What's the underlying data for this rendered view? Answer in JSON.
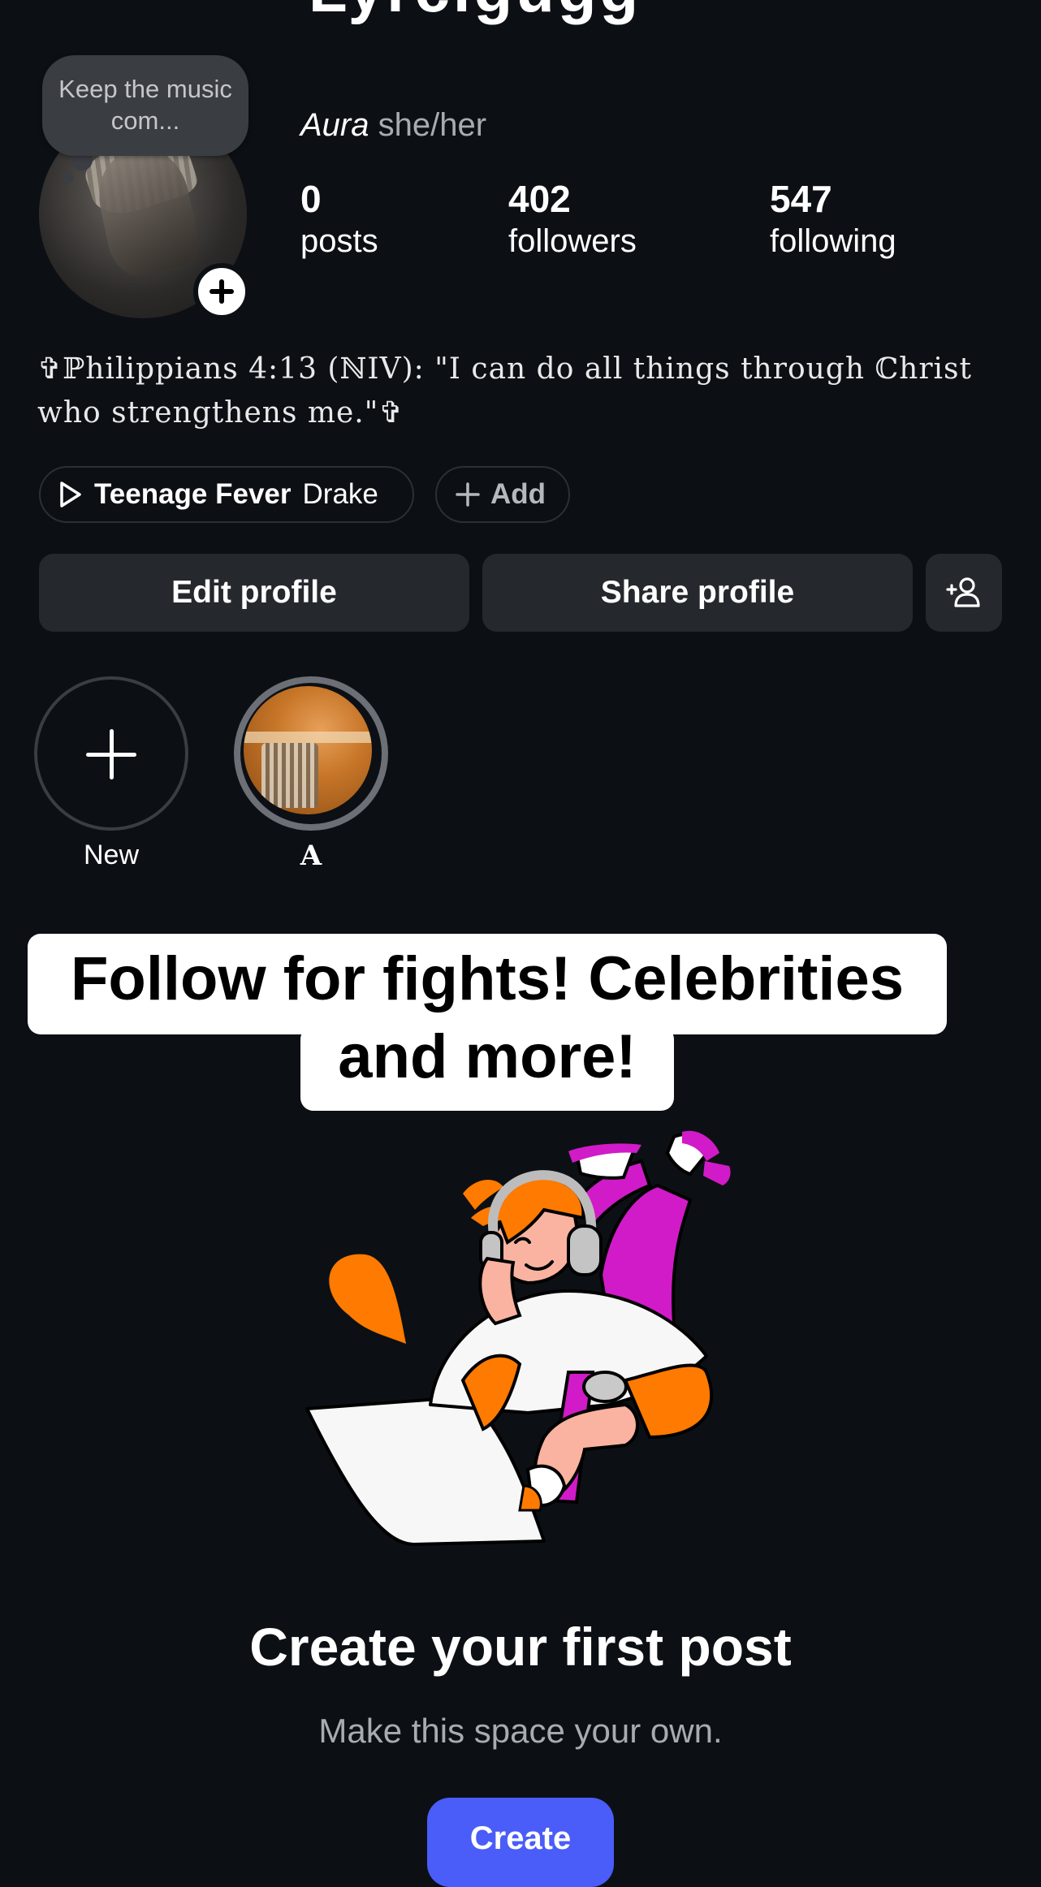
{
  "header": {
    "username_fragment": "Lyrcigugg"
  },
  "profile": {
    "note": "Keep the music com...",
    "name": "Aura",
    "pronouns": "she/her",
    "stats": [
      {
        "value": "0",
        "label": "posts"
      },
      {
        "value": "402",
        "label": "followers"
      },
      {
        "value": "547",
        "label": "following"
      }
    ],
    "bio": "✞ℙhilippians 4:13 (ℕIV): \"I can do all things through ℂhrist who strengthens me.\"✞",
    "music": {
      "song": "Teenage Fever",
      "artist": "Drake"
    },
    "add_label": "Add"
  },
  "buttons": {
    "edit": "Edit profile",
    "share": "Share profile",
    "suggest_icon": "add-person-icon"
  },
  "highlights": [
    {
      "label": "New",
      "icon": "plus-icon"
    },
    {
      "label": "𝐀"
    }
  ],
  "caption": {
    "line1": "Follow for fights! Celebrities",
    "line2": "and more!"
  },
  "empty_state": {
    "title": "Create your first post",
    "subtitle": "Make this space your own.",
    "button": "Create"
  },
  "colors": {
    "background": "#0c1014",
    "button_bg": "#25292e",
    "accent": "#4a5df9",
    "muted_text": "#a8abb1",
    "illustration_orange": "#ff7a00",
    "illustration_magenta": "#d11bc8"
  }
}
